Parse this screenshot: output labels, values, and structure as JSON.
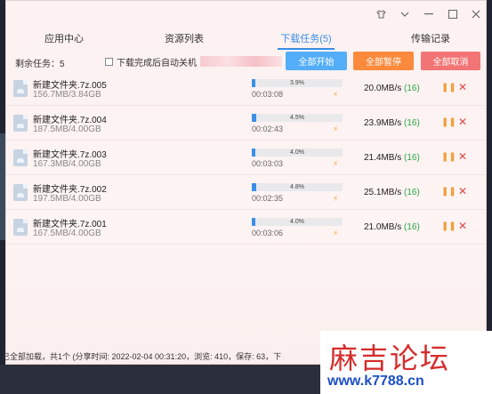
{
  "window": {
    "controls": [
      "shirt-icon",
      "chevron-down-icon",
      "minimize-icon",
      "maximize-icon",
      "close-icon"
    ]
  },
  "tabs": [
    {
      "label": "应用中心"
    },
    {
      "label": "资源列表"
    },
    {
      "label": "下载任务(5)",
      "active": true
    },
    {
      "label": "传输记录"
    }
  ],
  "toolbar": {
    "remain_label": "剩余任务：5",
    "auto_shutdown_label": "下载完成后自动关机",
    "auto_shutdown_checked": false,
    "start_all": "全部开始",
    "pause_all": "全部暂停",
    "cancel_all": "全部取消"
  },
  "tasks": [
    {
      "name": "新建文件夹.7z.005",
      "size": "156.7MB/3.84GB",
      "percent_text": "3.9%",
      "percent": 3.9,
      "elapsed": "00:03:08",
      "speed": "20.0MB/s",
      "connections": "(16)"
    },
    {
      "name": "新建文件夹.7z.004",
      "size": "187.5MB/4.00GB",
      "percent_text": "4.5%",
      "percent": 4.5,
      "elapsed": "00:02:43",
      "speed": "23.9MB/s",
      "connections": "(16)"
    },
    {
      "name": "新建文件夹.7z.003",
      "size": "167.3MB/4.00GB",
      "percent_text": "4.0%",
      "percent": 4.0,
      "elapsed": "00:03:03",
      "speed": "21.4MB/s",
      "connections": "(16)"
    },
    {
      "name": "新建文件夹.7z.002",
      "size": "197.5MB/4.00GB",
      "percent_text": "4.8%",
      "percent": 4.8,
      "elapsed": "00:02:35",
      "speed": "25.1MB/s",
      "connections": "(16)"
    },
    {
      "name": "新建文件夹.7z.001",
      "size": "167.5MB/4.00GB",
      "percent_text": "4.0%",
      "percent": 4.0,
      "elapsed": "00:03:06",
      "speed": "21.0MB/s",
      "connections": "(16)"
    }
  ],
  "status_bar": "已全部加载，共1个 (分享时间: 2022-02-04 00:31:20，浏览: 410，保存: 63，下",
  "watermark": {
    "title": "麻吉论坛",
    "url": "www.k7788.cn"
  },
  "colors": {
    "accent": "#3a8ee6",
    "start": "#54aef7",
    "pause": "#fb8a3c",
    "cancel": "#f27474",
    "progress": "#3c8fe8",
    "speed_conn": "#2aa84a",
    "watermark_red": "#d62b2b",
    "watermark_blue": "#1b4fc4"
  }
}
